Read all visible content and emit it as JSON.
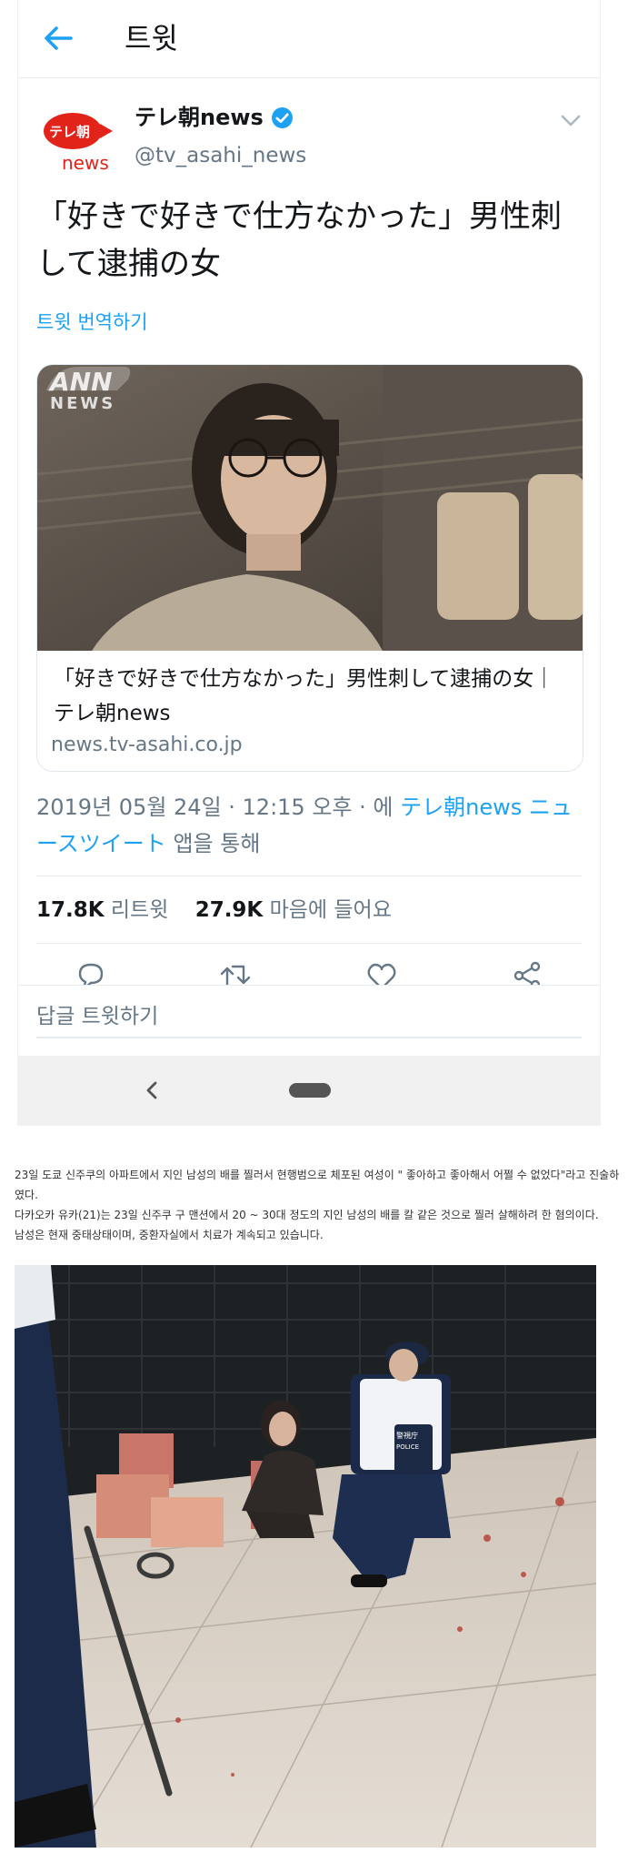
{
  "header": {
    "title": "트윗"
  },
  "author": {
    "name": "テレ朝news",
    "handle": "@tv_asahi_news",
    "logo_top": "テレ朝",
    "logo_bottom": "news"
  },
  "tweet": {
    "text": "「好きで好きで仕方なかった」男性刺して逮捕の女",
    "translate": "트윗 번역하기"
  },
  "card": {
    "watermark_top": "ANN",
    "watermark_bottom": "NEWS",
    "title": "「好きで好きで仕方なかった」男性刺して逮捕の女｜テレ朝news",
    "domain": "news.tv-asahi.co.jp"
  },
  "meta": {
    "datetime": "2019년 05월 24일 · 12:15 오후 · 에",
    "source_account": "テレ朝news",
    "source_app": "ニュースツイート",
    "via": "앱을 통해"
  },
  "stats": {
    "retweets_count": "17.8K",
    "retweets_label": "리트윗",
    "likes_count": "27.9K",
    "likes_label": "마음에 들어요"
  },
  "reply": {
    "placeholder": "답글 트윗하기"
  },
  "article": {
    "lines": [
      "23일 도쿄 신주쿠의 아파트에서 지인 남성의 배를 찔러서 현행범으로 체포된 여성이 \" 좋아하고 좋아해서 어쩔 수 없었다\"라고 진술하였다.",
      "다카오카 유카(21)는 23일 신주쿠 구 맨션에서 20 ~ 30대 정도의 지인 남성의 배를 칼 같은 것으로 찔러 살해하려 한 혐의이다.",
      "남성은 현재 중태상태이며, 중환자실에서 치료가 계속되고 있습니다."
    ]
  },
  "photo": {
    "police_patch": "警視庁",
    "police_label": "POLICE"
  },
  "colors": {
    "accent": "#1da1f2",
    "secondary_text": "#657786",
    "logo_red": "#e2231a"
  }
}
